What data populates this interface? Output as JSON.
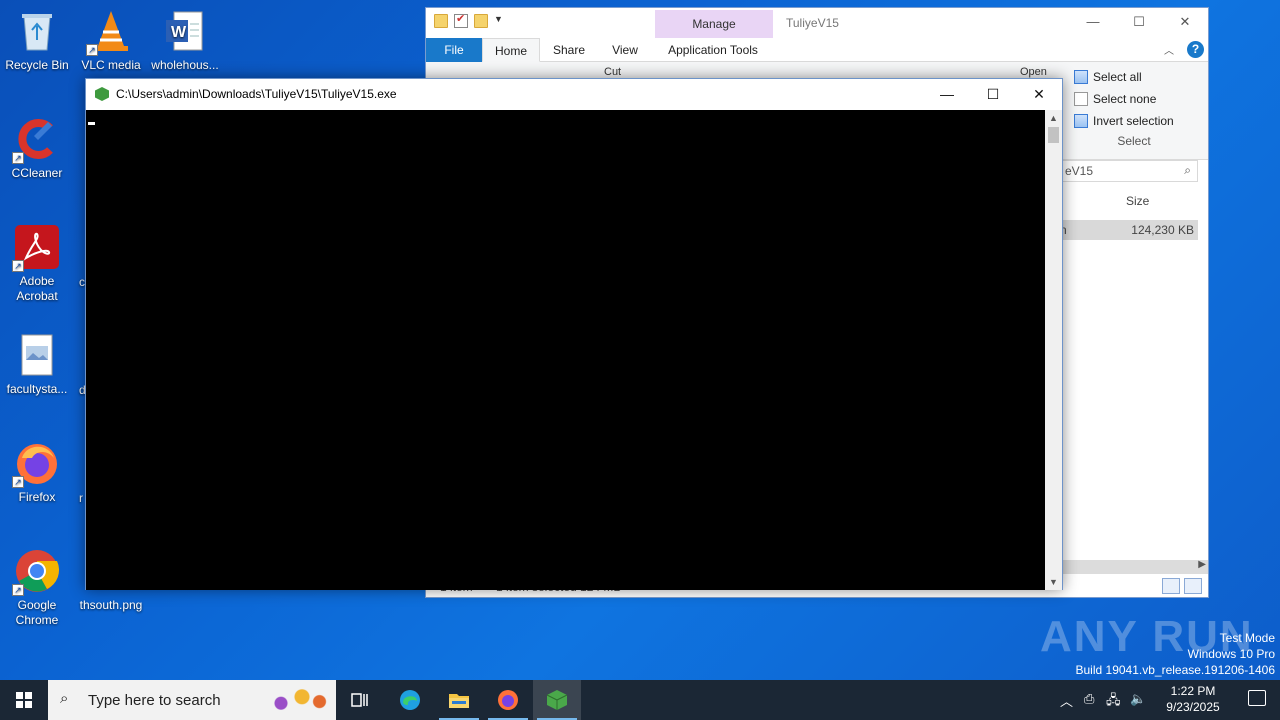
{
  "desktop": {
    "icons": [
      {
        "label": "Recycle Bin"
      },
      {
        "label": "VLC media"
      },
      {
        "label": "wholehous..."
      },
      {
        "label": "CCleaner"
      },
      {
        "label": "Adobe Acrobat"
      },
      {
        "label": "facultysta..."
      },
      {
        "label": "Firefox"
      },
      {
        "label": "Google Chrome"
      },
      {
        "label": "thsouth.png"
      }
    ],
    "partial_labels": [
      "c",
      "d",
      "r"
    ]
  },
  "explorer": {
    "title": "TuliyeV15",
    "manage_tab": "Manage",
    "tabs": [
      "File",
      "Home",
      "Share",
      "View",
      "Application Tools"
    ],
    "ribbon_hidden_text": "Cut",
    "open_label": "Open",
    "select": {
      "select_all": "Select all",
      "select_none": "Select none",
      "invert_selection": "Invert selection",
      "caption": "Select"
    },
    "search_text": "eV15",
    "columns": {
      "size": "Size"
    },
    "file_row": {
      "name": "n",
      "size": "124,230 KB"
    },
    "status": {
      "items": "1 item",
      "selected": "1 item selected  124 MB"
    }
  },
  "console": {
    "title": "C:\\Users\\admin\\Downloads\\TuliyeV15\\TuliyeV15.exe"
  },
  "watermark": "ANY RUN",
  "system_info": {
    "line1": "Test Mode",
    "line2": "Windows 10 Pro",
    "line3": "Build 19041.vb_release.191206-1406"
  },
  "taskbar": {
    "search_placeholder": "Type here to search",
    "time": "1:22 PM",
    "date": "9/23/2025"
  },
  "colors": {
    "desktop_bg": "#0b63d2",
    "taskbar_bg": "#1b2735",
    "manage_tab": "#e9d5f5",
    "file_tab": "#1979ca",
    "console_body": "#000000"
  }
}
